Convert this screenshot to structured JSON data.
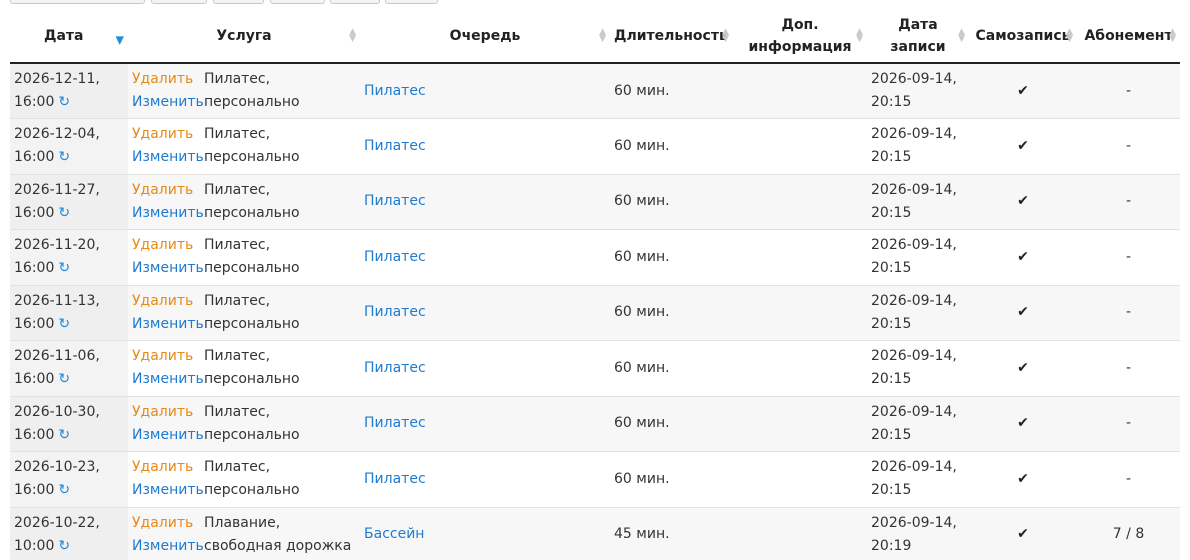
{
  "headers": {
    "date": "Дата",
    "service": "Услуга",
    "queue": "Очередь",
    "duration": "Длительность",
    "extra_line1": "Доп.",
    "extra_line2": "информация",
    "recorded_line1": "Дата",
    "recorded_line2": "записи",
    "self_booking": "Самозапись",
    "subscription": "Абонемент"
  },
  "icons": {
    "sort_active": "sort-desc-icon",
    "sort": "sort-icon",
    "repeat": "repeat-icon",
    "check": "check-icon"
  },
  "colors": {
    "delete": "#e58a16",
    "link": "#1e7bd0",
    "sort_active": "#1e90d6"
  },
  "rows": [
    {
      "date": "2026-12-11,",
      "time": "16:00",
      "delete": "Удалить",
      "edit": "Изменить",
      "service1": "Пилатес,",
      "service2": "персонально",
      "queue": "Пилатес",
      "duration": "60 мин.",
      "recorded1": "2026-09-14,",
      "recorded2": "20:15",
      "self": "✔",
      "subscription": "-"
    },
    {
      "date": "2026-12-04,",
      "time": "16:00",
      "delete": "Удалить",
      "edit": "Изменить",
      "service1": "Пилатес,",
      "service2": "персонально",
      "queue": "Пилатес",
      "duration": "60 мин.",
      "recorded1": "2026-09-14,",
      "recorded2": "20:15",
      "self": "✔",
      "subscription": "-"
    },
    {
      "date": "2026-11-27,",
      "time": "16:00",
      "delete": "Удалить",
      "edit": "Изменить",
      "service1": "Пилатес,",
      "service2": "персонально",
      "queue": "Пилатес",
      "duration": "60 мин.",
      "recorded1": "2026-09-14,",
      "recorded2": "20:15",
      "self": "✔",
      "subscription": "-"
    },
    {
      "date": "2026-11-20,",
      "time": "16:00",
      "delete": "Удалить",
      "edit": "Изменить",
      "service1": "Пилатес,",
      "service2": "персонально",
      "queue": "Пилатес",
      "duration": "60 мин.",
      "recorded1": "2026-09-14,",
      "recorded2": "20:15",
      "self": "✔",
      "subscription": "-"
    },
    {
      "date": "2026-11-13,",
      "time": "16:00",
      "delete": "Удалить",
      "edit": "Изменить",
      "service1": "Пилатес,",
      "service2": "персонально",
      "queue": "Пилатес",
      "duration": "60 мин.",
      "recorded1": "2026-09-14,",
      "recorded2": "20:15",
      "self": "✔",
      "subscription": "-"
    },
    {
      "date": "2026-11-06,",
      "time": "16:00",
      "delete": "Удалить",
      "edit": "Изменить",
      "service1": "Пилатес,",
      "service2": "персонально",
      "queue": "Пилатес",
      "duration": "60 мин.",
      "recorded1": "2026-09-14,",
      "recorded2": "20:15",
      "self": "✔",
      "subscription": "-"
    },
    {
      "date": "2026-10-30,",
      "time": "16:00",
      "delete": "Удалить",
      "edit": "Изменить",
      "service1": "Пилатес,",
      "service2": "персонально",
      "queue": "Пилатес",
      "duration": "60 мин.",
      "recorded1": "2026-09-14,",
      "recorded2": "20:15",
      "self": "✔",
      "subscription": "-"
    },
    {
      "date": "2026-10-23,",
      "time": "16:00",
      "delete": "Удалить",
      "edit": "Изменить",
      "service1": "Пилатес,",
      "service2": "персонально",
      "queue": "Пилатес",
      "duration": "60 мин.",
      "recorded1": "2026-09-14,",
      "recorded2": "20:15",
      "self": "✔",
      "subscription": "-"
    },
    {
      "date": "2026-10-22,",
      "time": "10:00",
      "delete": "Удалить",
      "edit": "Изменить",
      "service1": "Плавание,",
      "service2": "свободная дорожка",
      "queue": "Бассейн",
      "duration": "45 мин.",
      "recorded1": "2026-09-14,",
      "recorded2": "20:19",
      "self": "✔",
      "subscription": "7 / 8"
    }
  ]
}
